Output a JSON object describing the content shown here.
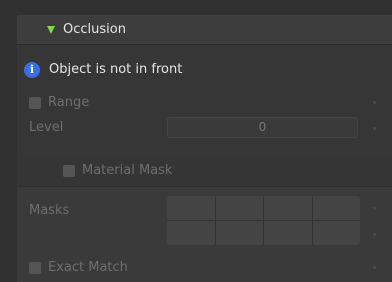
{
  "panel": {
    "title": "Occlusion",
    "info_message": "Object is not in front",
    "info_icon_glyph": "i",
    "accent_color": "#87d64b",
    "info_color": "#3a6ee3"
  },
  "range": {
    "label": "Range",
    "checked": false
  },
  "level": {
    "label": "Level",
    "value": "0"
  },
  "material_mask": {
    "label": "Material Mask",
    "checked": false,
    "masks_label": "Masks",
    "mask_cells": [
      false,
      false,
      false,
      false,
      false,
      false,
      false,
      false
    ]
  },
  "exact_match": {
    "label": "Exact Match",
    "checked": false
  }
}
